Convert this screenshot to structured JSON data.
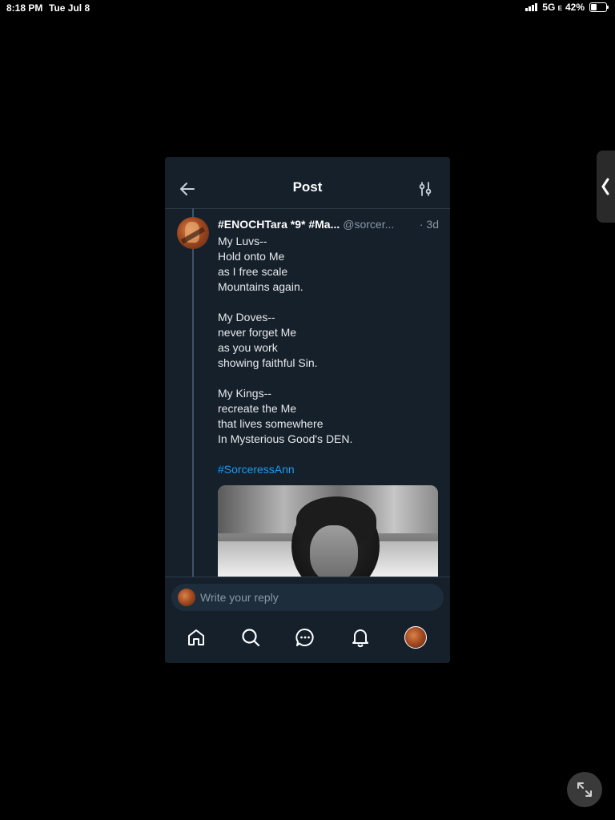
{
  "status_bar": {
    "time": "8:18 PM",
    "date": "Tue Jul 8",
    "network": "5G",
    "network_suffix": "E",
    "battery": "42%",
    "battery_level": 0.42
  },
  "header": {
    "title": "Post",
    "back_icon": "arrow-left-icon",
    "filter_icon": "sliders-icon"
  },
  "post": {
    "display_name": "#ENOCHTara *9* #Ma...",
    "handle": "@sorcer...",
    "time": "· 3d",
    "stanzas": [
      [
        "My Luvs--",
        "Hold onto Me",
        "as I free scale",
        "Mountains again."
      ],
      [
        "My Doves--",
        "never forget Me",
        "as you work",
        "showing faithful Sin."
      ],
      [
        "My Kings--",
        "recreate the Me",
        "that lives somewhere",
        "In Mysterious Good's DEN."
      ]
    ],
    "hashtag": "#SorceressAnn"
  },
  "reply": {
    "placeholder": "Write your reply"
  },
  "tabbar": {
    "items": [
      "home-icon",
      "search-icon",
      "chat-icon",
      "bell-icon",
      "profile-avatar"
    ]
  },
  "colors": {
    "background": "#15202b",
    "accent": "#1d9bf0",
    "muted": "#8899a6"
  }
}
